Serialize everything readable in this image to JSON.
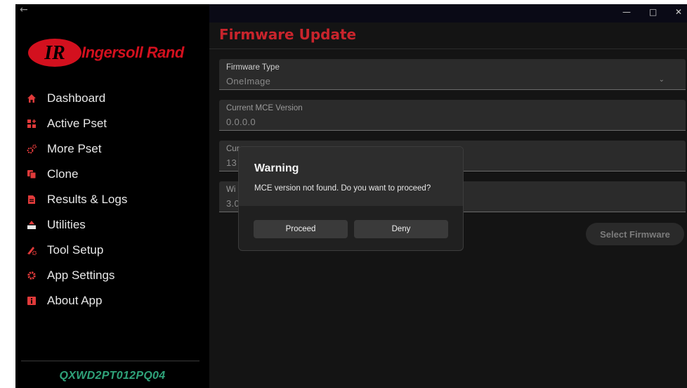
{
  "window": {
    "back_icon": "arrow-left-icon",
    "controls": [
      "minimize",
      "maximize",
      "close"
    ]
  },
  "brand": {
    "name": "Ingersoll Rand",
    "color": "#d3101e"
  },
  "sidebar": {
    "items": [
      {
        "label": "Dashboard",
        "icon": "home-icon"
      },
      {
        "label": "Active Pset",
        "icon": "grid-plus-icon"
      },
      {
        "label": "More Pset",
        "icon": "gears-icon"
      },
      {
        "label": "Clone",
        "icon": "copy-icon"
      },
      {
        "label": "Results & Logs",
        "icon": "file-icon"
      },
      {
        "label": "Utilities",
        "icon": "utilities-icon"
      },
      {
        "label": "Tool Setup",
        "icon": "tool-gear-icon"
      },
      {
        "label": "App Settings",
        "icon": "gear-icon"
      },
      {
        "label": "About App",
        "icon": "info-icon"
      }
    ],
    "device_id": "QXWD2PT012PQ04",
    "device_id_color": "#2fa37a"
  },
  "main": {
    "title": "Firmware Update",
    "title_color": "#c9242c",
    "fields": [
      {
        "label": "Firmware Type",
        "value": "OneImage"
      },
      {
        "label": "Current MCE Version",
        "value": "0.0.0.0"
      },
      {
        "label": "Cur",
        "value": "13"
      },
      {
        "label": "Wi",
        "value": "3.0"
      }
    ],
    "select_button": "Select Firmware"
  },
  "dialog": {
    "title": "Warning",
    "message": "MCE version not found. Do you want to proceed?",
    "proceed": "Proceed",
    "deny": "Deny"
  }
}
